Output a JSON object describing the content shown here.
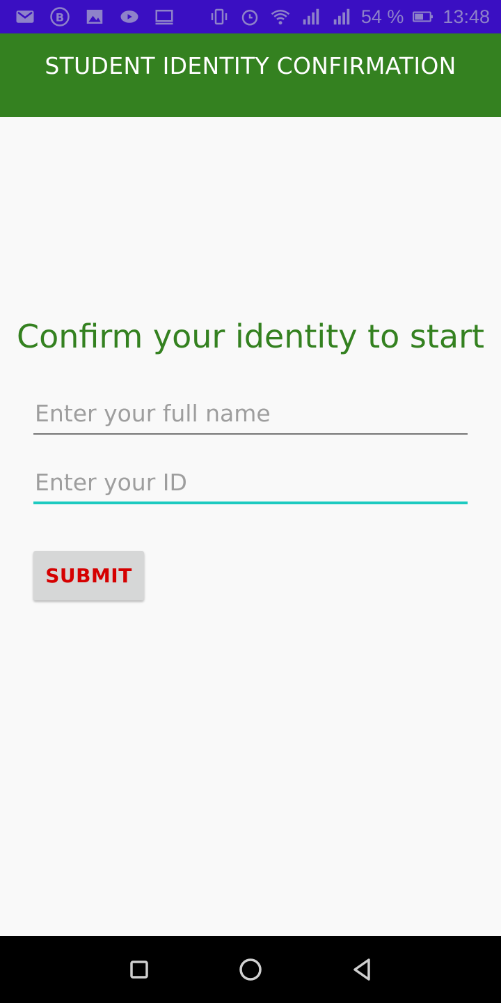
{
  "status_bar": {
    "battery": "54 %",
    "time": "13:48",
    "icons": [
      "gmail-icon",
      "bitcoin-icon",
      "image-icon",
      "video-icon",
      "cast-icon",
      "vibrate-icon",
      "alarm-icon",
      "wifi-icon",
      "signal-icon",
      "signal-icon",
      "battery-icon"
    ]
  },
  "app_bar": {
    "title": "STUDENT IDENTITY CONFIRMATION"
  },
  "form": {
    "heading": "Confirm your identity to start",
    "name_field": {
      "value": "",
      "placeholder": "Enter your full name"
    },
    "id_field": {
      "value": "",
      "placeholder": "Enter your ID"
    },
    "submit_label": "SUBMIT"
  },
  "colors": {
    "status_bar": "#3a0fc2",
    "app_bar": "#348120",
    "heading": "#348120",
    "focus_underline": "#1dcac0",
    "submit_text": "#d50000"
  },
  "nav_bar": {
    "icons": [
      "recents-square-icon",
      "home-circle-icon",
      "back-triangle-icon"
    ]
  }
}
